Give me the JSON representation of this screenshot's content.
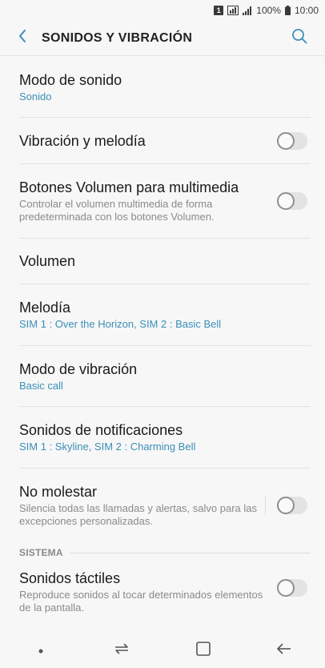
{
  "status_bar": {
    "sim_badge": "1",
    "battery_percent": "100%",
    "time": "10:00"
  },
  "header": {
    "title": "SONIDOS Y VIBRACIÓN"
  },
  "rows": [
    {
      "title": "Modo de sonido",
      "subtitle": "Sonido"
    },
    {
      "title": "Vibración y melodía",
      "toggle": false
    },
    {
      "title": "Botones Volumen para multimedia",
      "subtitle": "Controlar el volumen multimedia de forma predeterminada con los botones Volumen.",
      "toggle": false
    },
    {
      "title": "Volumen"
    },
    {
      "title": "Melodía",
      "subtitle": "SIM 1 : Over the Horizon, SIM 2 : Basic Bell"
    },
    {
      "title": "Modo de vibración",
      "subtitle": "Basic call"
    },
    {
      "title": "Sonidos de notificaciones",
      "subtitle": "SIM 1 : Skyline, SIM 2 : Charming Bell"
    },
    {
      "title": "No molestar",
      "subtitle": "Silencia todas las llamadas y alertas, salvo para las excepciones personalizadas.",
      "toggle": false
    }
  ],
  "section": {
    "label": "SISTEMA"
  },
  "system_rows": [
    {
      "title": "Sonidos táctiles",
      "subtitle": "Reproduce sonidos al tocar determinados elementos de la pantalla.",
      "toggle": false
    }
  ],
  "colors": {
    "accent": "#3a8fb7",
    "background": "#f7f7f7",
    "toggle_off_track": "#e3e3e3"
  },
  "icons": {
    "back": "arrow-left-icon",
    "search": "search-icon",
    "nav_dot": "dot-icon",
    "nav_recents": "recents-icon",
    "nav_home": "home-icon",
    "nav_back": "back-arrow-icon"
  }
}
